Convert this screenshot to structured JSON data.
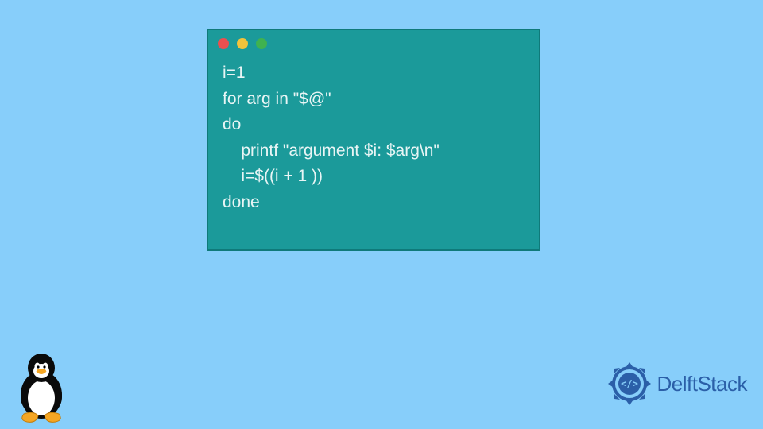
{
  "code": {
    "lines": [
      "i=1",
      "for arg in \"$@\"",
      "do",
      "    printf \"argument $i: $arg\\n\"",
      "    i=$((i + 1 ))",
      "done"
    ]
  },
  "brand": {
    "name": "DelftStack"
  },
  "colors": {
    "background": "#87cefa",
    "window": "#1b9a9a",
    "brand": "#2b5fa8"
  }
}
